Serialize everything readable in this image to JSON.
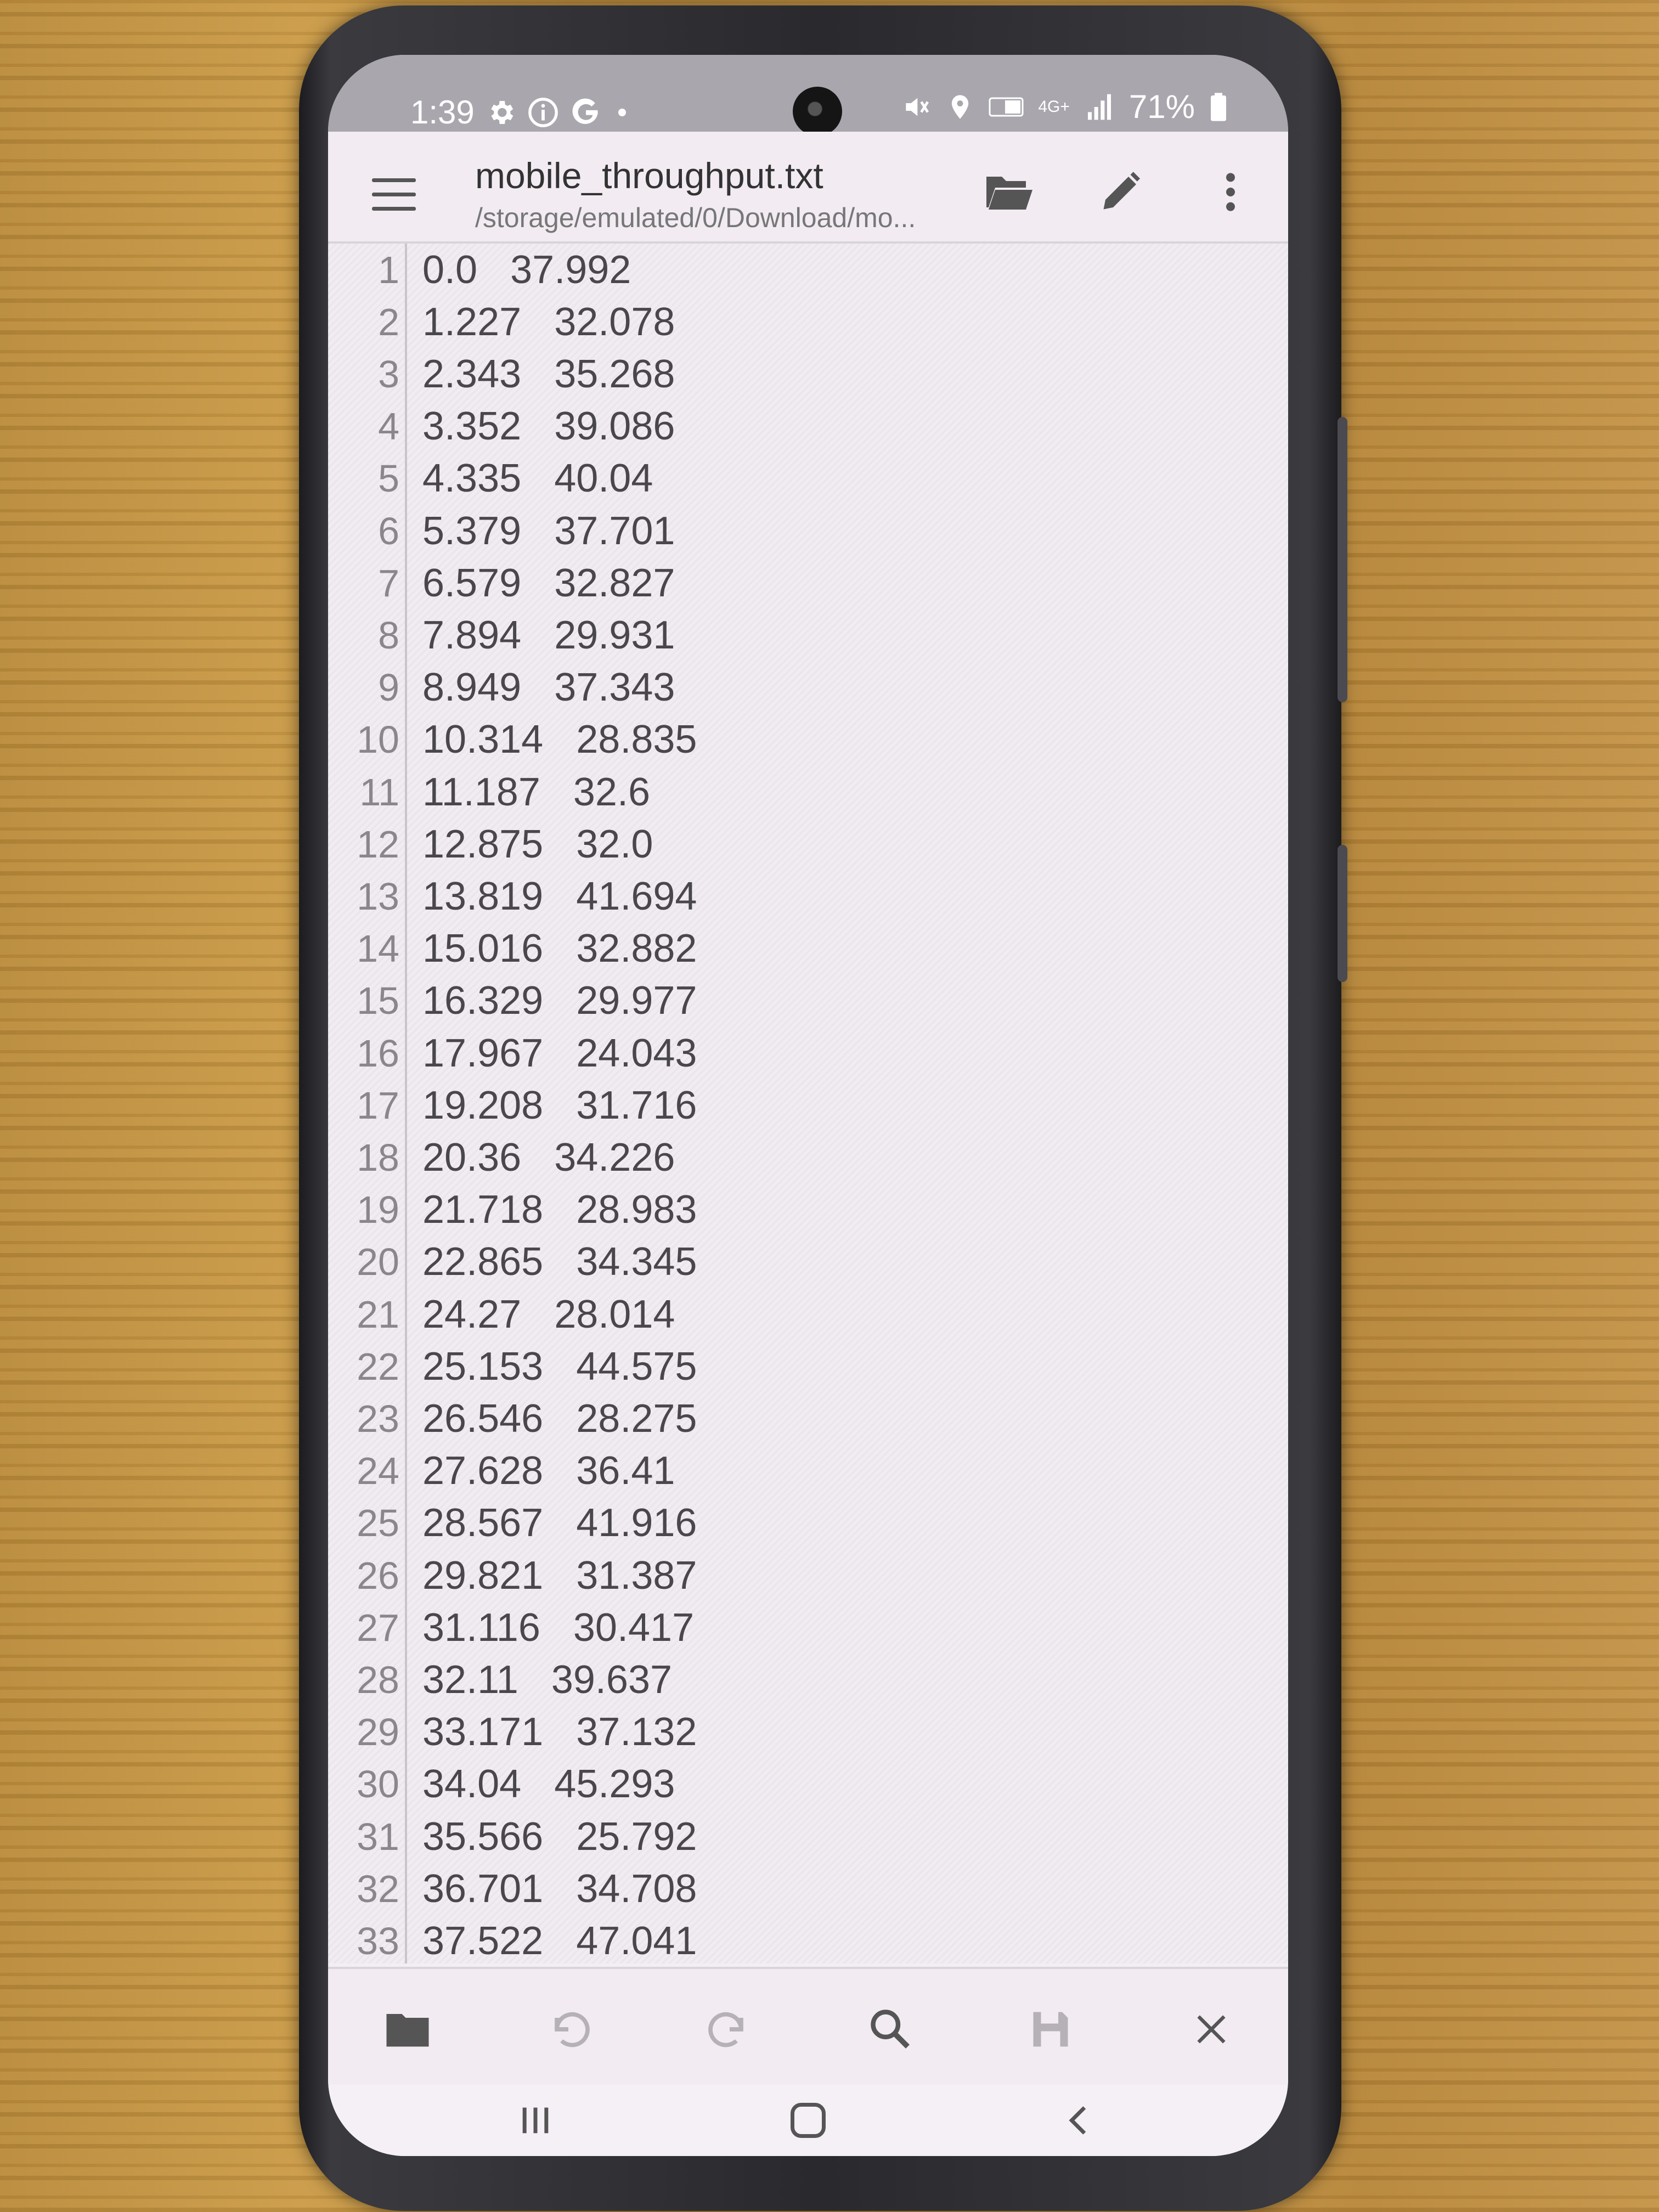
{
  "status_bar": {
    "time": "1:39",
    "battery": "71%",
    "network": "4G+"
  },
  "app_bar": {
    "filename": "mobile_throughput.txt",
    "path": "/storage/emulated/0/Download/mo..."
  },
  "editor": {
    "lines": [
      {
        "num": "1",
        "text": "0.0   37.992"
      },
      {
        "num": "2",
        "text": "1.227   32.078"
      },
      {
        "num": "3",
        "text": "2.343   35.268"
      },
      {
        "num": "4",
        "text": "3.352   39.086"
      },
      {
        "num": "5",
        "text": "4.335   40.04"
      },
      {
        "num": "6",
        "text": "5.379   37.701"
      },
      {
        "num": "7",
        "text": "6.579   32.827"
      },
      {
        "num": "8",
        "text": "7.894   29.931"
      },
      {
        "num": "9",
        "text": "8.949   37.343"
      },
      {
        "num": "10",
        "text": "10.314   28.835"
      },
      {
        "num": "11",
        "text": "11.187   32.6"
      },
      {
        "num": "12",
        "text": "12.875   32.0"
      },
      {
        "num": "13",
        "text": "13.819   41.694"
      },
      {
        "num": "14",
        "text": "15.016   32.882"
      },
      {
        "num": "15",
        "text": "16.329   29.977"
      },
      {
        "num": "16",
        "text": "17.967   24.043"
      },
      {
        "num": "17",
        "text": "19.208   31.716"
      },
      {
        "num": "18",
        "text": "20.36   34.226"
      },
      {
        "num": "19",
        "text": "21.718   28.983"
      },
      {
        "num": "20",
        "text": "22.865   34.345"
      },
      {
        "num": "21",
        "text": "24.27   28.014"
      },
      {
        "num": "22",
        "text": "25.153   44.575"
      },
      {
        "num": "23",
        "text": "26.546   28.275"
      },
      {
        "num": "24",
        "text": "27.628   36.41"
      },
      {
        "num": "25",
        "text": "28.567   41.916"
      },
      {
        "num": "26",
        "text": "29.821   31.387"
      },
      {
        "num": "27",
        "text": "31.116   30.417"
      },
      {
        "num": "28",
        "text": "32.11   39.637"
      },
      {
        "num": "29",
        "text": "33.171   37.132"
      },
      {
        "num": "30",
        "text": "34.04   45.293"
      },
      {
        "num": "31",
        "text": "35.566   25.792"
      },
      {
        "num": "32",
        "text": "36.701   34.708"
      },
      {
        "num": "33",
        "text": "37.522   47.041"
      }
    ]
  },
  "colors": {
    "status_bar_bg": "#a9a7ad",
    "editor_bg": "#f1ecf2",
    "text": "#4a474c",
    "line_number": "#8a868c",
    "icon": "#555555",
    "icon_disabled": "#b5b1b7"
  },
  "icons": {
    "app_bar": [
      "menu-icon",
      "folder-open-icon",
      "pencil-icon",
      "more-vert-icon"
    ],
    "bottom_bar": [
      "folder-icon",
      "undo-icon",
      "redo-icon",
      "search-icon",
      "save-icon",
      "close-icon"
    ],
    "nav_bar": [
      "recent-apps-icon",
      "home-icon",
      "back-icon"
    ]
  }
}
